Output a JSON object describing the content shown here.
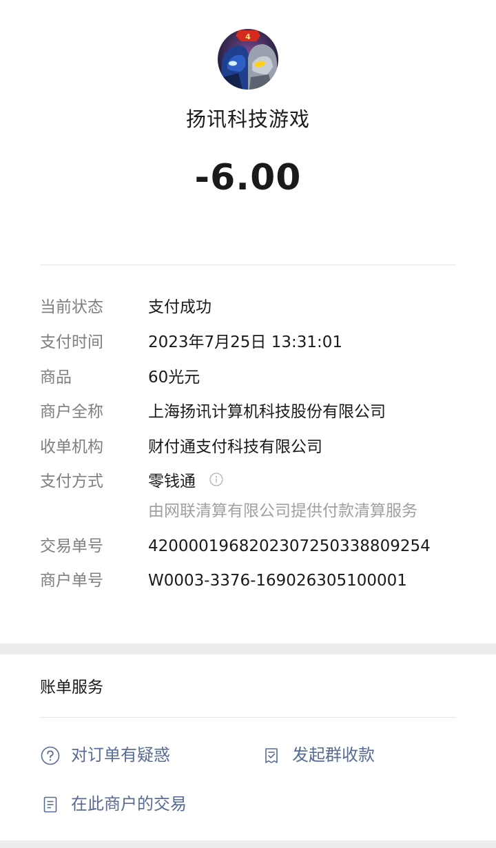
{
  "merchant": {
    "name": "扬讯科技游戏",
    "amount": "-6.00"
  },
  "details": [
    {
      "label": "当前状态",
      "value": "支付成功"
    },
    {
      "label": "支付时间",
      "value": "2023年7月25日 13:31:01"
    },
    {
      "label": "商品",
      "value": "60光元"
    },
    {
      "label": "商户全称",
      "value": "上海扬讯计算机科技股份有限公司"
    },
    {
      "label": "收单机构",
      "value": "财付通支付科技有限公司"
    },
    {
      "label": "支付方式",
      "value": "零钱通",
      "note": "由网联清算有限公司提供付款清算服务",
      "icon": "info-icon"
    },
    {
      "label": "交易单号",
      "value": "4200001968202307250338809254"
    },
    {
      "label": "商户单号",
      "value": "W0003-3376-169026305100001"
    }
  ],
  "bill_services": {
    "title": "账单服务",
    "items": [
      {
        "label": "对订单有疑惑",
        "icon": "question-circle-icon"
      },
      {
        "label": "发起群收款",
        "icon": "group-collect-icon"
      },
      {
        "label": "在此商户的交易",
        "icon": "document-list-icon"
      }
    ]
  },
  "colors": {
    "link": "#576b95",
    "label_gray": "#7f7f7f",
    "note_gray": "#a0a0a0",
    "background": "#ededed"
  }
}
